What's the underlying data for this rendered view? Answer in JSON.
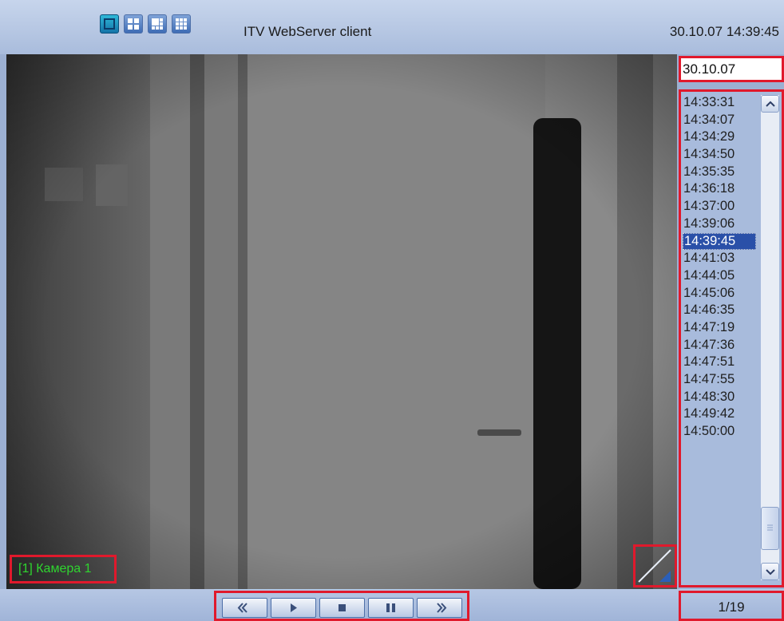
{
  "header": {
    "title": "ITV WebServer client",
    "datetime": "30.10.07 14:39:45",
    "layout_buttons": [
      "layout-1x1-icon",
      "layout-2x2-icon",
      "layout-1plus5-icon",
      "layout-3x3-icon"
    ]
  },
  "video": {
    "camera_label": "[1] Камера 1"
  },
  "archive": {
    "date": "30.10.07",
    "times": [
      "14:33:31",
      "14:34:07",
      "14:34:29",
      "14:34:50",
      "14:35:35",
      "14:36:18",
      "14:37:00",
      "14:39:06",
      "14:39:45",
      "14:41:03",
      "14:44:05",
      "14:45:06",
      "14:46:35",
      "14:47:19",
      "14:47:36",
      "14:47:51",
      "14:47:55",
      "14:48:30",
      "14:49:42",
      "14:50:00"
    ],
    "selected_time": "14:39:45",
    "page_counter": "1/19"
  },
  "playback": {
    "buttons": [
      "rewind-icon",
      "play-icon",
      "stop-icon",
      "pause-icon",
      "fast-forward-icon"
    ]
  },
  "colors": {
    "highlight": "#e0192c",
    "camera_label": "#2fd52f",
    "selection": "#2a50a8"
  }
}
